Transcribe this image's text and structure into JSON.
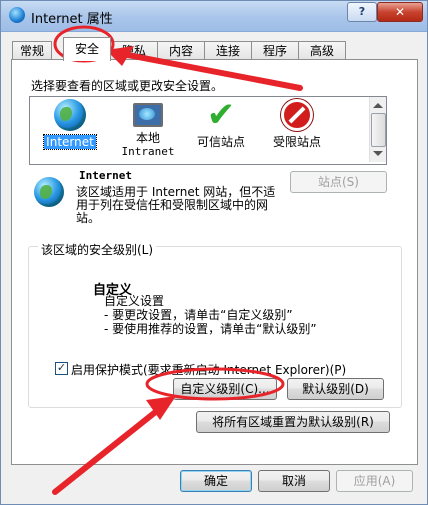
{
  "window": {
    "title": "Internet 属性",
    "help_label": "?",
    "close_label": "✕"
  },
  "tabs": [
    {
      "label": "常规"
    },
    {
      "label": "安全"
    },
    {
      "label": "隐私"
    },
    {
      "label": "内容"
    },
    {
      "label": "连接"
    },
    {
      "label": "程序"
    },
    {
      "label": "高级"
    }
  ],
  "security": {
    "instruction": "选择要查看的区域或更改安全设置。",
    "zones": [
      {
        "label": "Internet",
        "label2": "",
        "icon": "globe-icon",
        "selected": true
      },
      {
        "label": "本地",
        "label2": "Intranet",
        "icon": "local-intranet-icon",
        "selected": false
      },
      {
        "label": "可信站点",
        "label2": "",
        "icon": "trusted-sites-check-icon",
        "selected": false
      },
      {
        "label": "受限站点",
        "label2": "",
        "icon": "restricted-sites-icon",
        "selected": false
      }
    ],
    "zone_title": "Internet",
    "zone_description": "该区域适用于 Internet 网站，但不适用于列在受信任和受限制区域中的网站。",
    "sites_button": "站点(S)",
    "level_group_title": "该区域的安全级别(L)",
    "custom_title": "自定义",
    "custom_lines": [
      "自定义设置",
      "- 要更改设置，请单击“自定义级别”",
      "- 要使用推荐的设置，请单击“默认级别”"
    ],
    "protected_mode_label": "启用保护模式(要求重新启动 Internet Explorer)(P)",
    "protected_mode_checked": true,
    "custom_level_button": "自定义级别(C)...",
    "default_level_button": "默认级别(D)",
    "reset_all_button": "将所有区域重置为默认级别(R)"
  },
  "footer": {
    "ok": "确定",
    "cancel": "取消",
    "apply": "应用(A)"
  },
  "colors": {
    "annotation_red": "#e8242b",
    "selection_blue": "#3399ff"
  }
}
